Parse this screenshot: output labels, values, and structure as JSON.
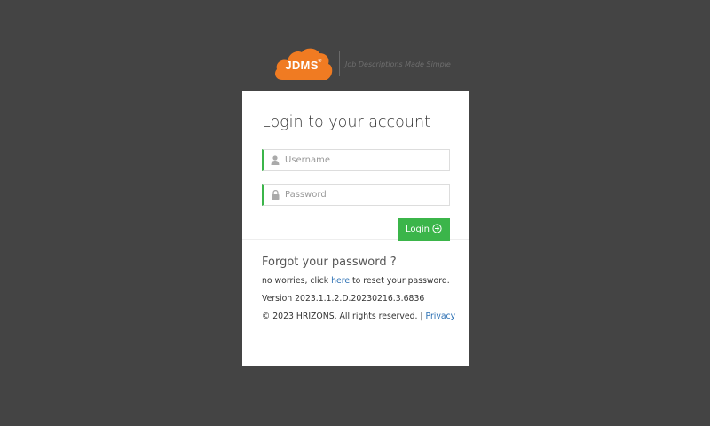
{
  "logo": {
    "brand": "JDMS",
    "trademark": "®",
    "tagline": "Job Descriptions Made Simple"
  },
  "login": {
    "title": "Login to your account",
    "username_placeholder": "Username",
    "password_placeholder": "Password",
    "username_value": "",
    "password_value": "",
    "button_label": "Login"
  },
  "forgot": {
    "title": "Forgot your password ?",
    "text_before": "no worries, click ",
    "link_label": "here",
    "text_after": " to reset your password."
  },
  "version": "Version 2023.1.1.2.D.20230216.3.6836",
  "footer": {
    "copyright": "© 2023 HRIZONS. All rights reserved.",
    "separator": " | ",
    "privacy_label": "Privacy"
  },
  "colors": {
    "background": "#444444",
    "card": "#ffffff",
    "accent_green": "#3bb54a",
    "brand_orange": "#f07b22",
    "link_blue": "#2a6fb3"
  },
  "icons": {
    "username": "user-icon",
    "password": "lock-icon",
    "login": "arrow-circle-right-icon"
  }
}
